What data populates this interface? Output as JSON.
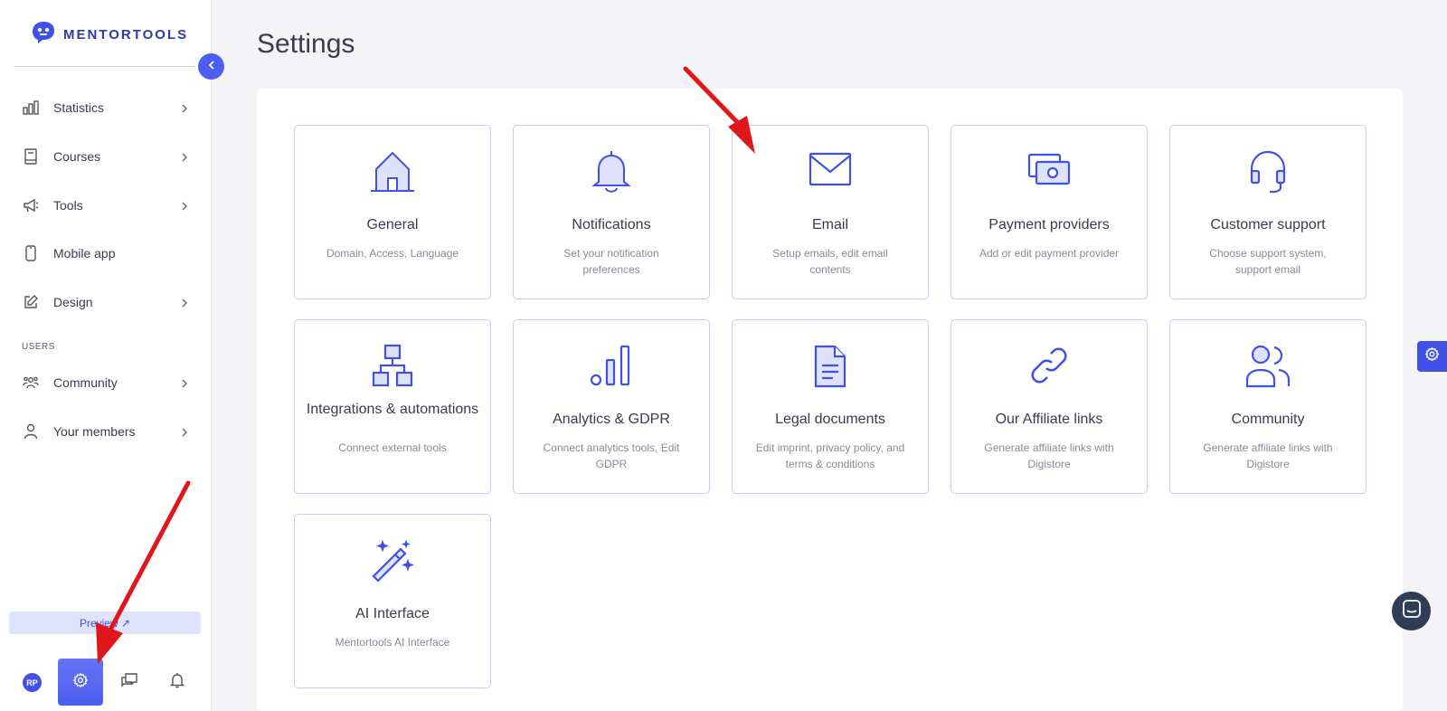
{
  "brand": {
    "name": "MENTORTOOLS"
  },
  "sidebar": {
    "items": [
      {
        "label": "Statistics",
        "icon": "bar-chart-icon",
        "has_chevron": true
      },
      {
        "label": "Courses",
        "icon": "book-icon",
        "has_chevron": true
      },
      {
        "label": "Tools",
        "icon": "megaphone-icon",
        "has_chevron": true
      },
      {
        "label": "Mobile app",
        "icon": "phone-icon",
        "has_chevron": false
      },
      {
        "label": "Design",
        "icon": "pencil-square-icon",
        "has_chevron": true
      }
    ],
    "section_users": "USERS",
    "user_items": [
      {
        "label": "Community",
        "icon": "people-group-icon",
        "has_chevron": true
      },
      {
        "label": "Your members",
        "icon": "user-icon",
        "has_chevron": true
      }
    ],
    "preview_label": "Preview ↗",
    "avatar_initials": "RP"
  },
  "page": {
    "title": "Settings"
  },
  "cards": [
    {
      "title": "General",
      "desc": "Domain, Access, Language",
      "icon": "home-icon"
    },
    {
      "title": "Notifications",
      "desc": "Set your notification preferences",
      "icon": "bell-icon"
    },
    {
      "title": "Email",
      "desc": "Setup emails, edit email contents",
      "icon": "envelope-icon"
    },
    {
      "title": "Payment providers",
      "desc": "Add or edit payment provider",
      "icon": "money-icon"
    },
    {
      "title": "Customer support",
      "desc": "Choose support system, support email",
      "icon": "headset-icon"
    },
    {
      "title": "Integrations & automations",
      "desc": "Connect external tools",
      "icon": "hierarchy-icon"
    },
    {
      "title": "Analytics & GDPR",
      "desc": "Connect analytics tools, Edit GDPR",
      "icon": "analytics-icon"
    },
    {
      "title": "Legal documents",
      "desc": "Edit imprint, privacy policy, and terms & conditions",
      "icon": "document-icon"
    },
    {
      "title": "Our Affiliate links",
      "desc": "Generate affiliate links with Digistore",
      "icon": "link-icon"
    },
    {
      "title": "Community",
      "desc": "Generate affiliate links with Digistore",
      "icon": "users-icon"
    },
    {
      "title": "AI Interface",
      "desc": "Mentortools AI Interface",
      "icon": "magic-wand-icon"
    }
  ],
  "colors": {
    "accent": "#3f51e6",
    "card_border": "#c9cbf4",
    "arrow": "#e0161b"
  }
}
